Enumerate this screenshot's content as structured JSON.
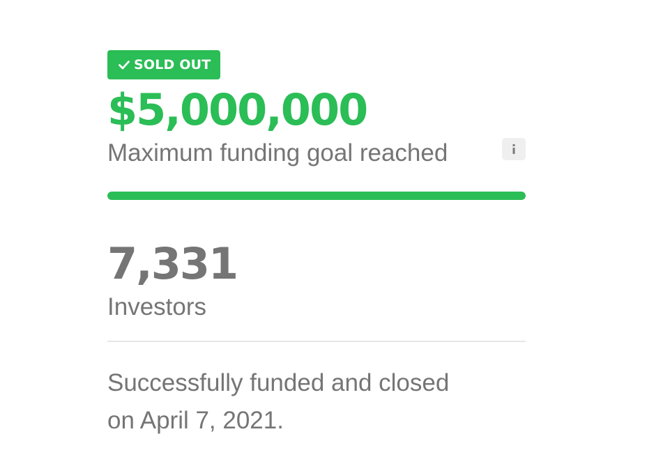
{
  "badge": {
    "icon": "check-icon",
    "label": "SOLD OUT",
    "color": "#2bbd56"
  },
  "funding": {
    "amount": "$5,000,000",
    "goal_text": "Maximum funding goal reached",
    "info_icon": "info-icon",
    "progress_fraction": 1.0,
    "accent_color": "#2bbd56"
  },
  "investors": {
    "count": "7,331",
    "label": "Investors"
  },
  "closing": {
    "text": "Successfully funded and closed on April 7, 2021."
  }
}
